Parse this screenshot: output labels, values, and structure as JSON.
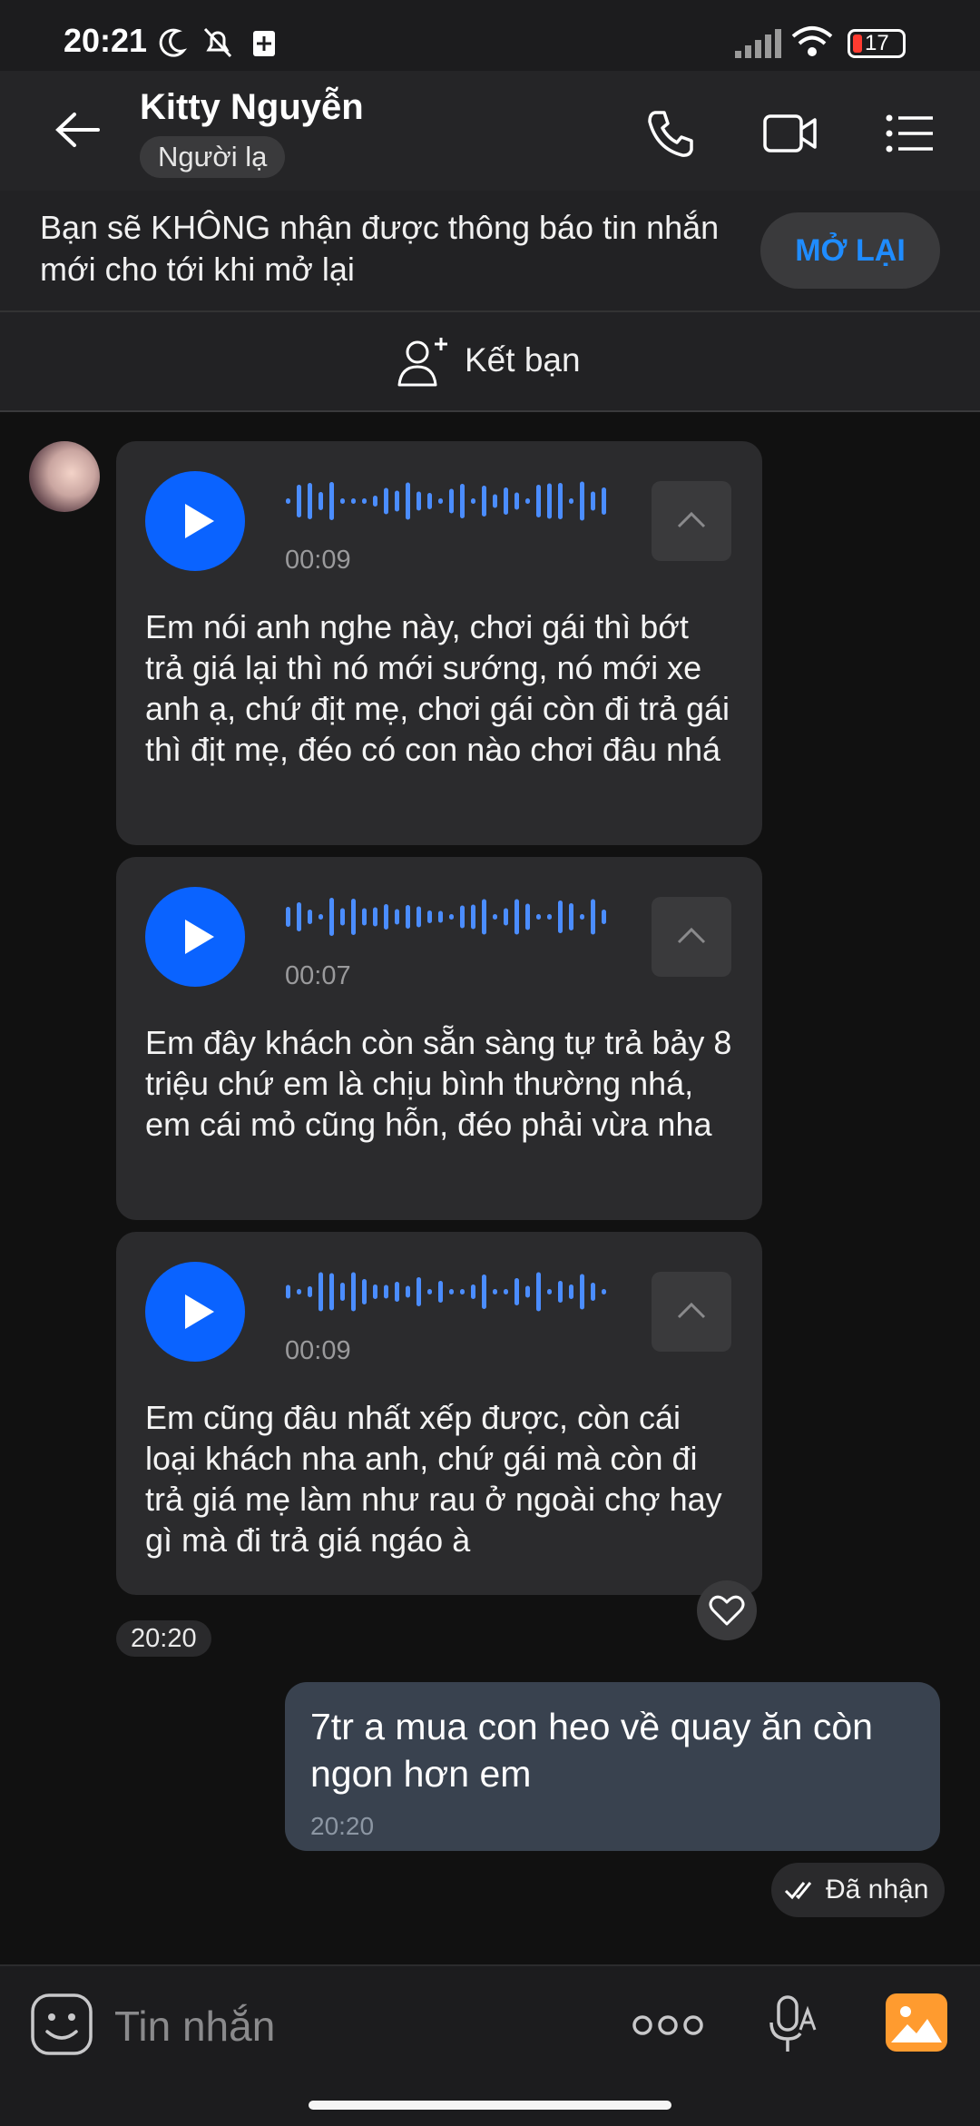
{
  "status_bar": {
    "time": "20:21",
    "battery": "17"
  },
  "header": {
    "name": "Kitty Nguyễn",
    "tag": "Người lạ"
  },
  "notice": {
    "text": "Bạn sẽ KHÔNG nhận được thông báo tin nhắn mới cho tới khi mở lại",
    "button": "MỞ LẠI"
  },
  "friend_bar": {
    "label": "Kết bạn"
  },
  "voice_messages": [
    {
      "duration": "00:09",
      "transcript": "Em nói anh nghe này, chơi gái thì bớt trả giá lại thì nó mới sướng, nó mới xe anh ạ, chứ địt mẹ, chơi gái còn đi trả gái thì địt mẹ, đéo có con nào chơi đâu nhá"
    },
    {
      "duration": "00:07",
      "transcript": "Em đây khách còn sẵn sàng tự trả bảy 8 triệu chứ em là chịu bình thường nhá, em cái mỏ cũng hỗn, đéo phải vừa nha"
    },
    {
      "duration": "00:09",
      "transcript": "Em cũng đâu nhất xếp được, còn cái loại khách nha anh, chứ gái mà còn đi trả giá mẹ làm như rau ở ngoài chợ hay gì mà đi trả giá ngáo à"
    }
  ],
  "received_time": "20:20",
  "outgoing": {
    "text": "7tr a mua con heo về quay ăn còn ngon hơn em",
    "time": "20:20",
    "status": "Đã nhận"
  },
  "input": {
    "placeholder": "Tin nhắn"
  },
  "colors": {
    "accent": "#0a63ff",
    "waveform": "#4b8dff",
    "gallery": "#ff9b2f"
  }
}
